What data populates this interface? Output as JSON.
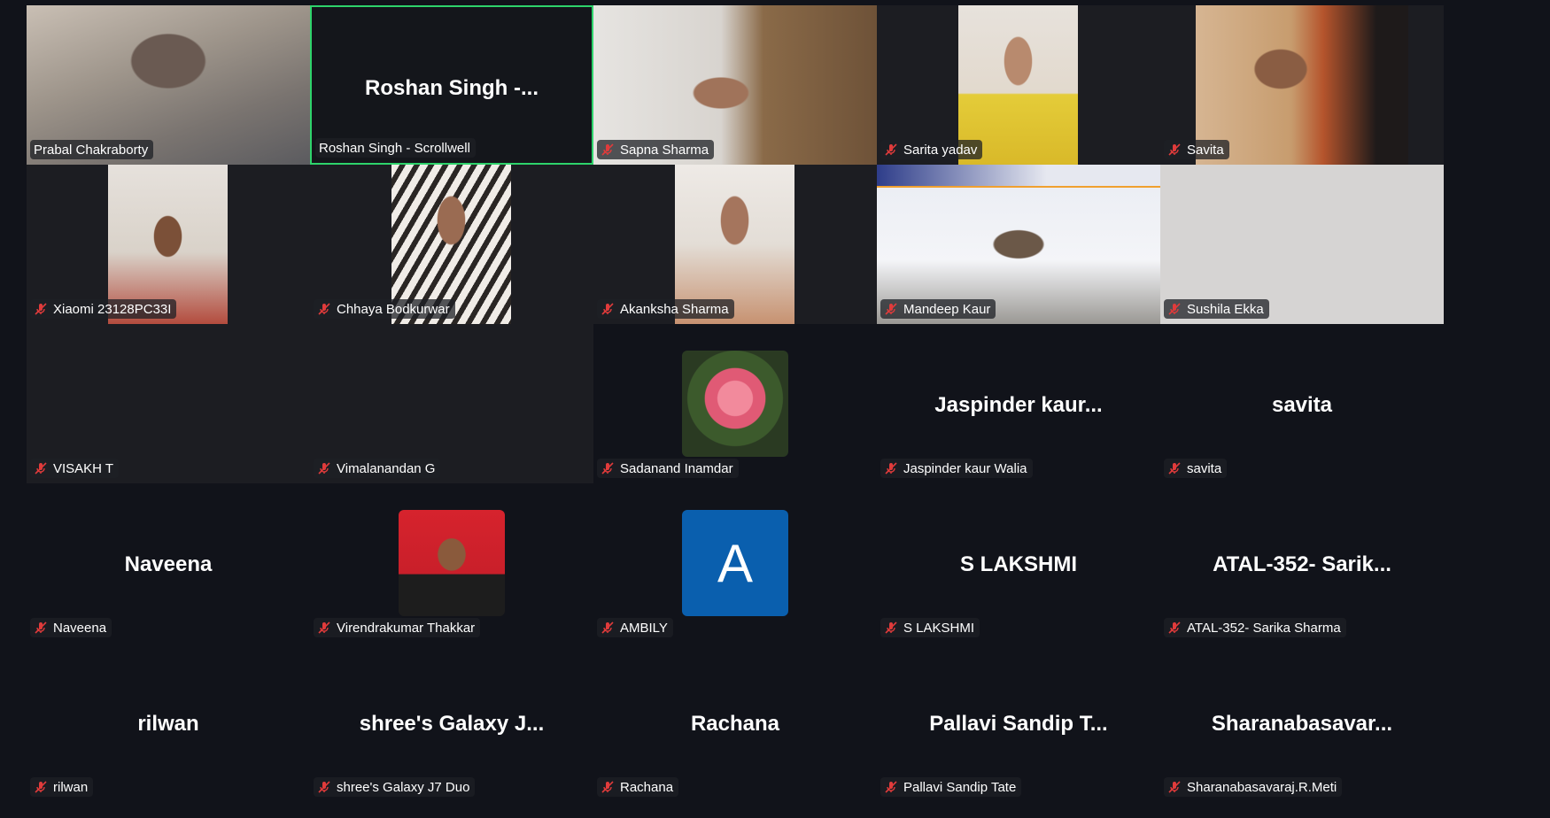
{
  "colors": {
    "background": "#11131a",
    "tile": "#1c1d22",
    "active_speaker_border": "#2ed36b",
    "muted_icon": "#e03b3b",
    "avatar_letter_bg": "#0a5fae"
  },
  "participants": [
    {
      "name": "Prabal Chakraborty",
      "tile_text": "",
      "muted": false,
      "view": "video",
      "speaking": false
    },
    {
      "name": "Roshan Singh - Scrollwell",
      "tile_text": "Roshan Singh -...",
      "muted": false,
      "view": "name",
      "speaking": true
    },
    {
      "name": "Sapna Sharma",
      "tile_text": "",
      "muted": true,
      "view": "video",
      "speaking": false
    },
    {
      "name": "Sarita yadav",
      "tile_text": "",
      "muted": true,
      "view": "video",
      "speaking": false
    },
    {
      "name": "Savita",
      "tile_text": "",
      "muted": true,
      "view": "video",
      "speaking": false
    },
    {
      "name": "Xiaomi 23128PC33I",
      "tile_text": "",
      "muted": true,
      "view": "video",
      "speaking": false
    },
    {
      "name": "Chhaya Bodkurwar",
      "tile_text": "",
      "muted": true,
      "view": "video",
      "speaking": false
    },
    {
      "name": "Akanksha Sharma",
      "tile_text": "",
      "muted": true,
      "view": "video",
      "speaking": false
    },
    {
      "name": "Mandeep Kaur",
      "tile_text": "",
      "muted": true,
      "view": "video",
      "speaking": false
    },
    {
      "name": "Sushila Ekka",
      "tile_text": "",
      "muted": true,
      "view": "video",
      "speaking": false
    },
    {
      "name": "VISAKH T",
      "tile_text": "",
      "muted": true,
      "view": "blank",
      "speaking": false
    },
    {
      "name": "Vimalanandan G",
      "tile_text": "",
      "muted": true,
      "view": "blank",
      "speaking": false
    },
    {
      "name": "Sadanand Inamdar",
      "tile_text": "",
      "muted": true,
      "view": "avatar",
      "avatar": "flower-photo",
      "speaking": false
    },
    {
      "name": "Jaspinder kaur Walia",
      "tile_text": "Jaspinder kaur...",
      "muted": true,
      "view": "name",
      "speaking": false
    },
    {
      "name": "savita",
      "tile_text": "savita",
      "muted": true,
      "view": "name",
      "speaking": false
    },
    {
      "name": "Naveena",
      "tile_text": "Naveena",
      "muted": true,
      "view": "name",
      "speaking": false
    },
    {
      "name": "Virendrakumar Thakkar",
      "tile_text": "",
      "muted": true,
      "view": "avatar",
      "avatar": "profile-photo",
      "speaking": false
    },
    {
      "name": "AMBILY",
      "tile_text": "",
      "muted": true,
      "view": "avatar",
      "avatar": "letter",
      "avatar_letter": "A",
      "speaking": false
    },
    {
      "name": "S LAKSHMI",
      "tile_text": "S LAKSHMI",
      "muted": true,
      "view": "name",
      "speaking": false
    },
    {
      "name": "ATAL-352- Sarika Sharma",
      "tile_text": "ATAL-352- Sarik...",
      "muted": true,
      "view": "name",
      "speaking": false
    },
    {
      "name": "rilwan",
      "tile_text": "rilwan",
      "muted": true,
      "view": "name",
      "speaking": false
    },
    {
      "name": "shree's Galaxy J7 Duo",
      "tile_text": "shree's Galaxy J...",
      "muted": true,
      "view": "name",
      "speaking": false
    },
    {
      "name": "Rachana",
      "tile_text": "Rachana",
      "muted": true,
      "view": "name",
      "speaking": false
    },
    {
      "name": "Pallavi Sandip Tate",
      "tile_text": "Pallavi Sandip T...",
      "muted": true,
      "view": "name",
      "speaking": false
    },
    {
      "name": "Sharanabasavaraj.R.Meti",
      "tile_text": "Sharanabasavar...",
      "muted": true,
      "view": "name",
      "speaking": false
    }
  ]
}
